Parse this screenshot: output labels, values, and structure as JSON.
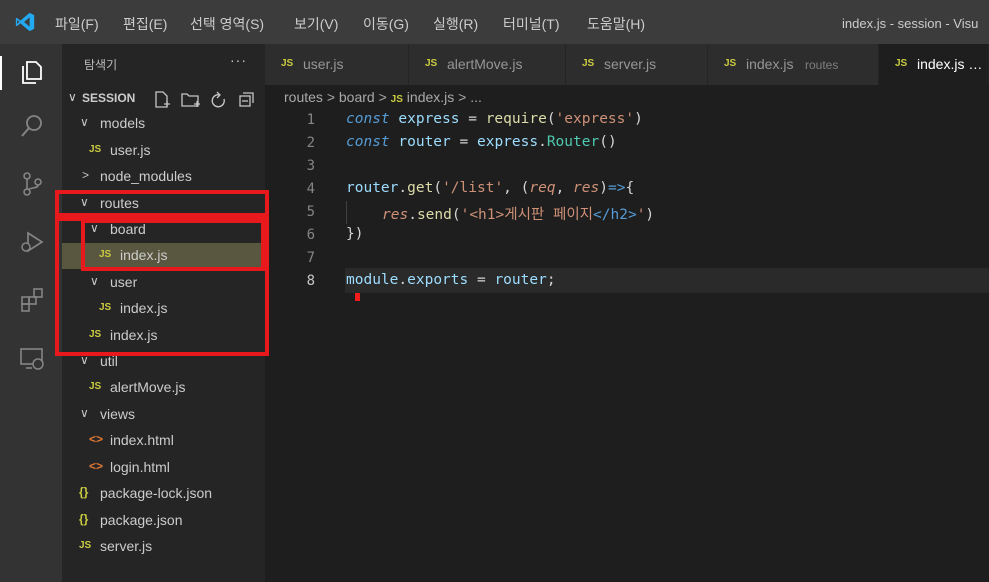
{
  "titlebar": {
    "menu": [
      "파일(F)",
      "편집(E)",
      "선택 영역(S)",
      "보기(V)",
      "이동(G)",
      "실행(R)",
      "터미널(T)",
      "도움말(H)"
    ],
    "window_title": "index.js - session - Visu"
  },
  "sidebar": {
    "title": "탐색기",
    "more": "···",
    "section": "SESSION",
    "tree": [
      {
        "type": "folder",
        "name": "models",
        "expanded": true
      },
      {
        "type": "js",
        "name": "user.js"
      },
      {
        "type": "folder",
        "name": "node_modules",
        "expanded": false
      },
      {
        "type": "folder",
        "name": "routes",
        "expanded": true
      },
      {
        "type": "folder",
        "name": "board",
        "expanded": true
      },
      {
        "type": "js",
        "name": "index.js",
        "selected": true
      },
      {
        "type": "folder",
        "name": "user",
        "expanded": true
      },
      {
        "type": "js",
        "name": "index.js"
      },
      {
        "type": "js",
        "name": "index.js"
      },
      {
        "type": "folder",
        "name": "util",
        "expanded": true
      },
      {
        "type": "js",
        "name": "alertMove.js"
      },
      {
        "type": "folder",
        "name": "views",
        "expanded": true
      },
      {
        "type": "html",
        "name": "index.html"
      },
      {
        "type": "html",
        "name": "login.html"
      },
      {
        "type": "json",
        "name": "package-lock.json"
      },
      {
        "type": "json",
        "name": "package.json"
      },
      {
        "type": "js",
        "name": "server.js"
      }
    ]
  },
  "icons": {
    "js_badge": "JS",
    "html_badge": "<>",
    "json_badge": "{}",
    "chevron_down": "∨",
    "chevron_right": ">"
  },
  "tabs": [
    {
      "label": "user.js",
      "desc": ""
    },
    {
      "label": "alertMove.js",
      "desc": ""
    },
    {
      "label": "server.js",
      "desc": ""
    },
    {
      "label": "index.js",
      "desc": "routes"
    },
    {
      "label": "index.js …",
      "desc": "",
      "active": true
    }
  ],
  "breadcrumb": {
    "parts": [
      "routes",
      "board",
      "index.js",
      "..."
    ],
    "sep": ">"
  },
  "editor": {
    "line_numbers": [
      "1",
      "2",
      "3",
      "4",
      "5",
      "6",
      "7",
      "8"
    ],
    "current_line": 8,
    "lines": {
      "l1": {
        "kw": "const",
        "name": "express",
        "eq": "=",
        "fn": "require",
        "open": "(",
        "str": "'express'",
        "close": ")"
      },
      "l2": {
        "kw": "const",
        "name": "router",
        "eq": "=",
        "obj": "express",
        "dot": ".",
        "cls": "Router",
        "call": "()"
      },
      "l4": {
        "obj": "router",
        "dot": ".",
        "fn": "get",
        "open": "(",
        "str": "'/list'",
        "comma": ", ",
        "p1open": "(",
        "p1": "req",
        "sep": ", ",
        "p2": "res",
        "p1close": ")",
        "arrow": "=>",
        "brace": "{"
      },
      "l5": {
        "obj": "res",
        "dot": ".",
        "fn": "send",
        "open": "(",
        "q1": "'",
        "tag1": "<h1>",
        "text": "게시판 페이지",
        "tag2": "</h2>",
        "q2": "'",
        "close": ")"
      },
      "l6": {
        "text": "})"
      },
      "l8": {
        "obj": "module",
        "dot": ".",
        "prop": "exports",
        "eq": "=",
        "val": "router",
        "semi": ";"
      }
    }
  },
  "colors": {
    "annotation_red": "#e8191c",
    "selection": "#5a5740",
    "accent_blue": "#0e7ad3"
  }
}
